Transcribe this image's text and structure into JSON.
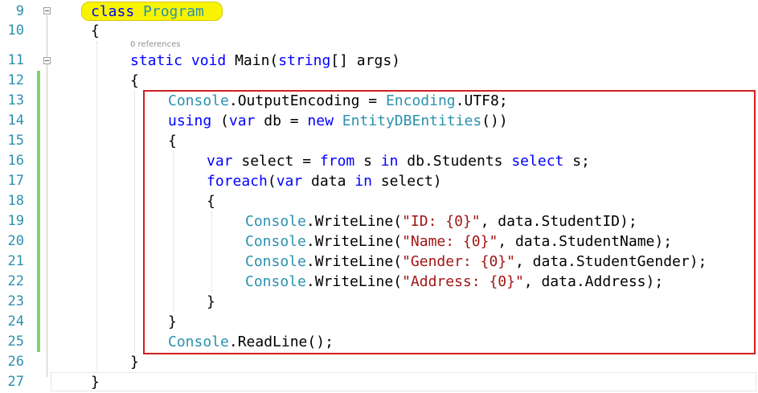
{
  "editor": {
    "codelens": "0 references",
    "lines": [
      {
        "n": "9",
        "parts": [
          [
            "kw",
            "class"
          ],
          [
            "t",
            " "
          ],
          [
            "ty",
            "Program"
          ]
        ]
      },
      {
        "n": "10",
        "parts": [
          [
            "t",
            "{"
          ]
        ]
      },
      {
        "n": "11",
        "parts": [
          [
            "kw",
            "static"
          ],
          [
            "t",
            " "
          ],
          [
            "kw",
            "void"
          ],
          [
            "t",
            " Main("
          ],
          [
            "kw",
            "string"
          ],
          [
            "t",
            "[] args)"
          ]
        ]
      },
      {
        "n": "12",
        "parts": [
          [
            "t",
            "{"
          ]
        ]
      },
      {
        "n": "13",
        "parts": [
          [
            "ty",
            "Console"
          ],
          [
            "t",
            ".OutputEncoding = "
          ],
          [
            "ty",
            "Encoding"
          ],
          [
            "t",
            ".UTF8;"
          ]
        ]
      },
      {
        "n": "14",
        "parts": [
          [
            "kw",
            "using"
          ],
          [
            "t",
            " ("
          ],
          [
            "kw",
            "var"
          ],
          [
            "t",
            " db = "
          ],
          [
            "kw",
            "new"
          ],
          [
            "t",
            " "
          ],
          [
            "ty",
            "EntityDBEntities"
          ],
          [
            "t",
            "())"
          ]
        ]
      },
      {
        "n": "15",
        "parts": [
          [
            "t",
            "{"
          ]
        ]
      },
      {
        "n": "16",
        "parts": [
          [
            "kw",
            "var"
          ],
          [
            "t",
            " select = "
          ],
          [
            "kw",
            "from"
          ],
          [
            "t",
            " s "
          ],
          [
            "kw",
            "in"
          ],
          [
            "t",
            " db.Students "
          ],
          [
            "kw",
            "select"
          ],
          [
            "t",
            " s;"
          ]
        ]
      },
      {
        "n": "17",
        "parts": [
          [
            "kw",
            "foreach"
          ],
          [
            "t",
            "("
          ],
          [
            "kw",
            "var"
          ],
          [
            "t",
            " data "
          ],
          [
            "kw",
            "in"
          ],
          [
            "t",
            " select)"
          ]
        ]
      },
      {
        "n": "18",
        "parts": [
          [
            "t",
            "{"
          ]
        ]
      },
      {
        "n": "19",
        "parts": [
          [
            "ty",
            "Console"
          ],
          [
            "t",
            ".WriteLine("
          ],
          [
            "st",
            "\"ID: {0}\""
          ],
          [
            "t",
            ", data.StudentID);"
          ]
        ]
      },
      {
        "n": "20",
        "parts": [
          [
            "ty",
            "Console"
          ],
          [
            "t",
            ".WriteLine("
          ],
          [
            "st",
            "\"Name: {0}\""
          ],
          [
            "t",
            ", data.StudentName);"
          ]
        ]
      },
      {
        "n": "21",
        "parts": [
          [
            "ty",
            "Console"
          ],
          [
            "t",
            ".WriteLine("
          ],
          [
            "st",
            "\"Gender: {0}\""
          ],
          [
            "t",
            ", data.StudentGender);"
          ]
        ]
      },
      {
        "n": "22",
        "parts": [
          [
            "ty",
            "Console"
          ],
          [
            "t",
            ".WriteLine("
          ],
          [
            "st",
            "\"Address: {0}\""
          ],
          [
            "t",
            ", data.Address);"
          ]
        ]
      },
      {
        "n": "23",
        "parts": [
          [
            "t",
            "}"
          ]
        ]
      },
      {
        "n": "24",
        "parts": [
          [
            "t",
            "}"
          ]
        ]
      },
      {
        "n": "25",
        "parts": [
          [
            "ty",
            "Console"
          ],
          [
            "t",
            ".ReadLine();"
          ]
        ]
      },
      {
        "n": "26",
        "parts": [
          [
            "t",
            "}"
          ]
        ]
      },
      {
        "n": "27",
        "parts": [
          [
            "t",
            "}"
          ]
        ]
      }
    ]
  }
}
